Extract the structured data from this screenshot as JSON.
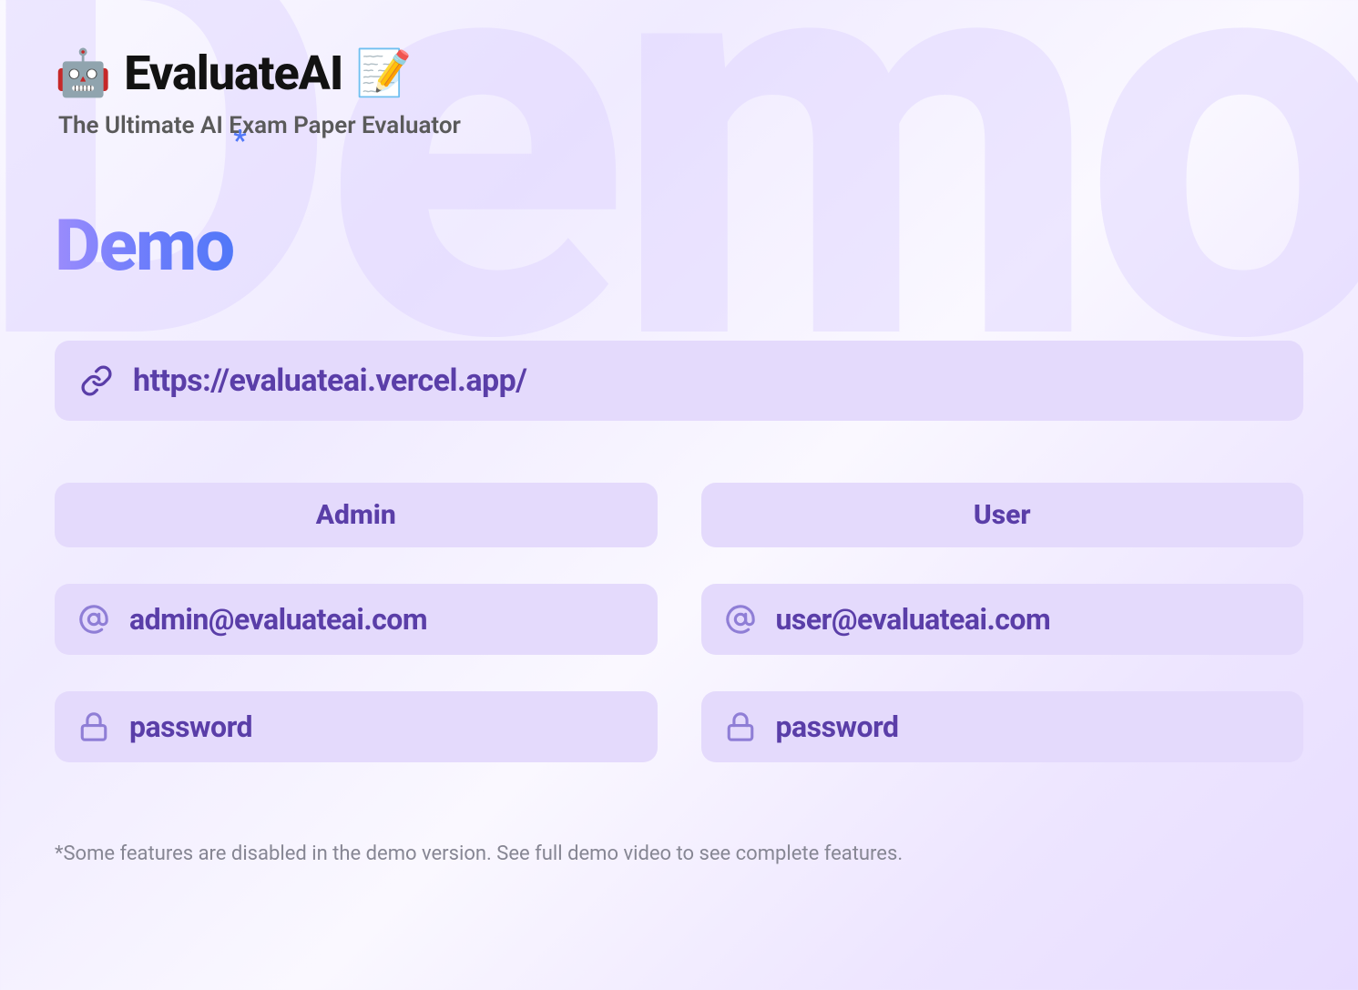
{
  "bg_text": "Demo",
  "header": {
    "emoji_left": "🤖",
    "title": "EvaluateAI",
    "emoji_right": "📝",
    "tagline": "The Ultimate AI Exam Paper Evaluator"
  },
  "section": {
    "title": "Demo",
    "star": "*"
  },
  "url": "https://evaluateai.vercel.app/",
  "admin": {
    "label": "Admin",
    "email": "admin@evaluateai.com",
    "password": "password"
  },
  "user": {
    "label": "User",
    "email": "user@evaluateai.com",
    "password": "password"
  },
  "footnote": "*Some features are disabled in the demo version. See full demo video to see complete features."
}
